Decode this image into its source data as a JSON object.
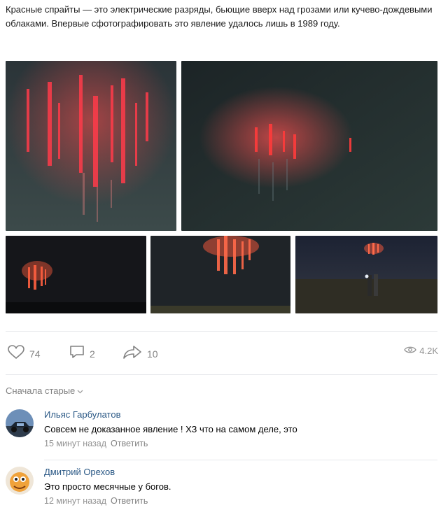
{
  "post": {
    "text": "Красные спрайты — это электрические разряды, бьющие вверх над грозами или кучево-дождевыми облаками. Впервые сфотографировать это явление удалось лишь в 1989 году."
  },
  "actions": {
    "likes": "74",
    "comments": "2",
    "shares": "10",
    "views": "4.2K"
  },
  "comments_section": {
    "sort_label": "Сначала старые"
  },
  "comments": [
    {
      "author": "Ильяс Гарбулатов",
      "text": "Совсем не доказанное явление ! ХЗ что на самом деле, это",
      "time": "15 минут назад",
      "reply": "Ответить"
    },
    {
      "author": "Дмитрий Орехов",
      "text": "Это просто месячные у богов.",
      "time": "12 минут назад",
      "reply": "Ответить"
    }
  ],
  "colors": {
    "link": "#2a5885",
    "muted": "#828282",
    "sprite": "#ff3b3b"
  }
}
